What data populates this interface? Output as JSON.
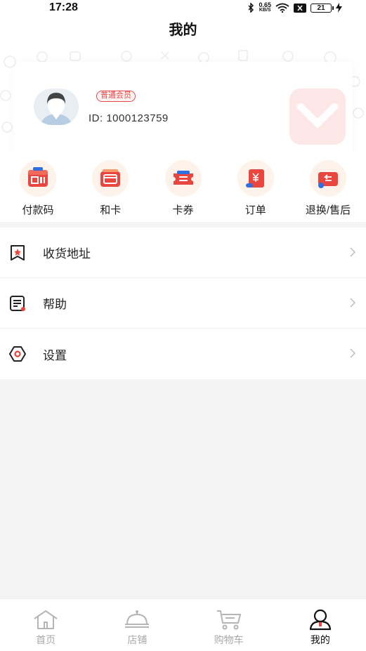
{
  "status": {
    "time": "17:28",
    "net_speed_value": "0.65",
    "net_speed_unit": "KB/S",
    "battery": "21"
  },
  "page_title": "我的",
  "profile": {
    "badge": "普通会员",
    "user_id": "ID:  1000123759"
  },
  "quick_actions": [
    {
      "label": "付款码",
      "icon": "payment-code-icon"
    },
    {
      "label": "和卡",
      "icon": "card-icon"
    },
    {
      "label": "卡券",
      "icon": "coupon-icon"
    },
    {
      "label": "订单",
      "icon": "order-icon"
    },
    {
      "label": "退换/售后",
      "icon": "return-icon"
    }
  ],
  "menu": [
    {
      "label": "收货地址",
      "icon": "address-icon"
    },
    {
      "label": "帮助",
      "icon": "help-icon"
    },
    {
      "label": "设置",
      "icon": "settings-icon"
    }
  ],
  "tabs": [
    {
      "label": "首页",
      "icon": "home-icon",
      "active": false
    },
    {
      "label": "店铺",
      "icon": "store-icon",
      "active": false
    },
    {
      "label": "购物车",
      "icon": "cart-icon",
      "active": false
    },
    {
      "label": "我的",
      "icon": "profile-icon",
      "active": true
    }
  ],
  "colors": {
    "accent": "#e84a4a",
    "icon_bg": "#fdf3ea",
    "background": "#f4f4f4"
  }
}
